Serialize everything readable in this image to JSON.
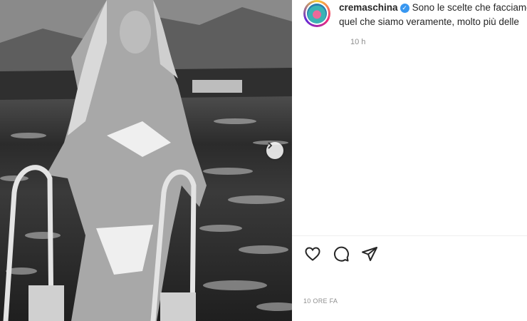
{
  "post": {
    "username": "cremaschina",
    "caption_text": "Sono le scelte che facciamo",
    "caption_line2": "quel che siamo veramente, molto più delle",
    "time_ago": "10 h",
    "timestamp": "10 ORE FA",
    "verified_mark": "✓"
  },
  "icons": {
    "next": "chevron-right-icon",
    "like": "heart-icon",
    "comment": "comment-icon",
    "share": "paper-plane-icon"
  },
  "colors": {
    "verified": "#3897f0",
    "text": "#262626",
    "muted": "#8e8e8e"
  }
}
